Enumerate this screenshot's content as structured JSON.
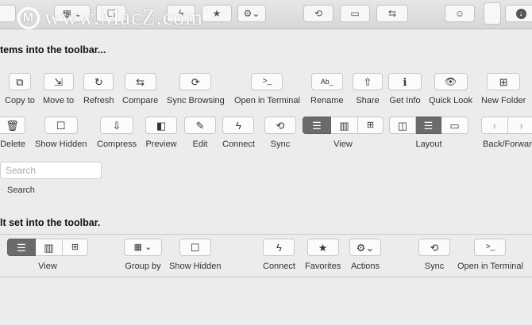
{
  "watermark": {
    "logo_letter": "M",
    "text": "www.MacZ.com"
  },
  "headings": {
    "drag_items": "tems into the toolbar...",
    "drag_default": "lt set into the toolbar."
  },
  "row1": [
    {
      "label": "Copy to",
      "glyph": "⧉"
    },
    {
      "label": "Move to",
      "glyph": "⇲"
    },
    {
      "label": "Refresh",
      "glyph": "↻"
    },
    {
      "label": "Compare",
      "glyph": "⇆"
    },
    {
      "label": "Sync Browsing",
      "glyph": "⟳"
    },
    {
      "label": "Open in Terminal",
      "glyph": ">_"
    },
    {
      "label": "Rename",
      "glyph": "Ab_"
    },
    {
      "label": "Share",
      "glyph": "⇧"
    },
    {
      "label": "Get Info",
      "glyph": "ℹ"
    },
    {
      "label": "Quick Look",
      "glyph": "👁"
    },
    {
      "label": "New Folder",
      "glyph": "⊞"
    }
  ],
  "row2": [
    {
      "label": "Delete",
      "glyph": "🗑"
    },
    {
      "label": "Show Hidden",
      "glyph": "☐"
    },
    {
      "label": "Compress",
      "glyph": "⇩"
    },
    {
      "label": "Preview",
      "glyph": "◧"
    },
    {
      "label": "Edit",
      "glyph": "✎"
    },
    {
      "label": "Connect",
      "glyph": "ϟ"
    },
    {
      "label": "Sync",
      "glyph": "⟲"
    },
    {
      "label": "View"
    },
    {
      "label": "Layout"
    },
    {
      "label": "Back/Forward"
    }
  ],
  "search": {
    "placeholder": "Search",
    "label": "Search"
  },
  "default_bar": {
    "view": "View",
    "group_by": "Group by",
    "show_hidden": "Show Hidden",
    "connect": "Connect",
    "favorites": "Favorites",
    "actions": "Actions",
    "sync": "Sync",
    "open_in_terminal": "Open in Terminal"
  }
}
